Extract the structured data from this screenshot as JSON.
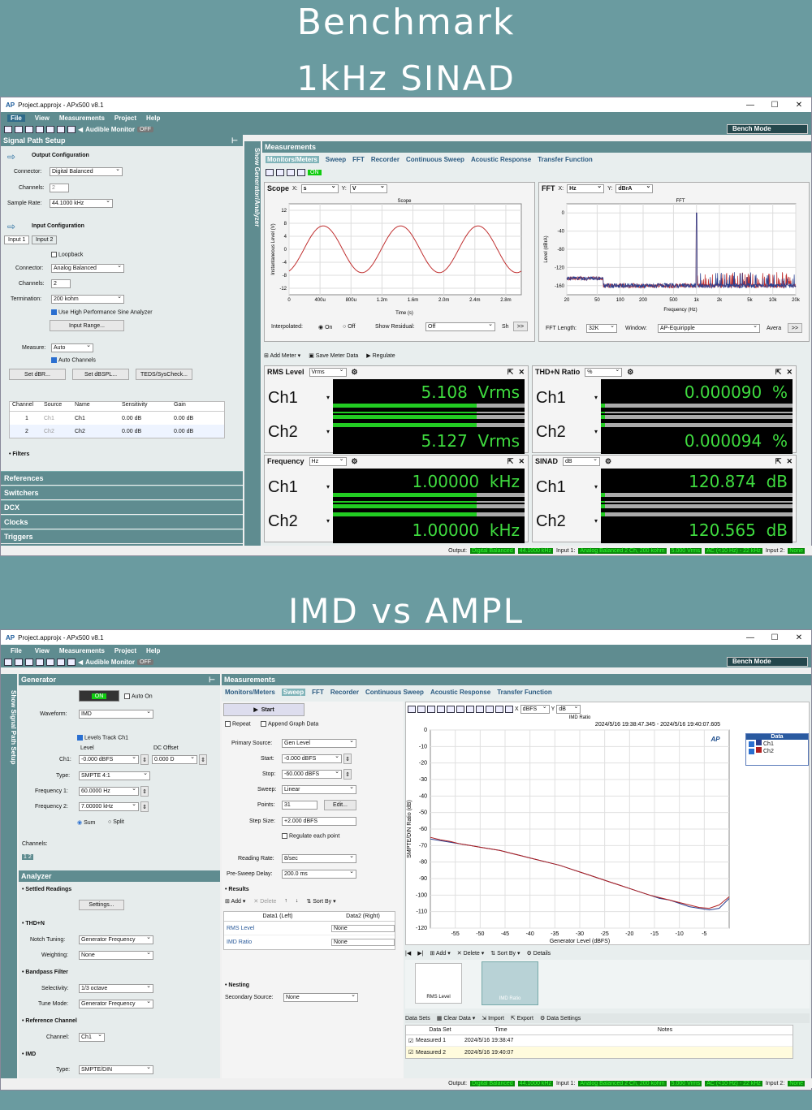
{
  "banner": {
    "line1": "Benchmark",
    "line2": "1kHz SINAD",
    "line3": "IMD vs AMPL"
  },
  "window": {
    "title": "Project.approjx - APx500 v8.1",
    "controls": [
      "—",
      "☐",
      "✕"
    ]
  },
  "menu": [
    "File",
    "View",
    "Measurements",
    "Project",
    "Help"
  ],
  "toolbar": {
    "audible": "Audible Monitor",
    "off": "OFF",
    "mode": "Bench Mode"
  },
  "top": {
    "signal_path_title": "Signal Path Setup",
    "show_gen": "Show Generator/Analyzer",
    "output_config": "Output Configuration",
    "connector_label": "Connector:",
    "connector_out": "Digital Balanced",
    "channels_label": "Channels:",
    "channels_out": "2",
    "sample_rate_label": "Sample Rate:",
    "sample_rate": "44.1000 kHz",
    "input_config": "Input Configuration",
    "input_tabs": [
      "Input 1",
      "Input 2"
    ],
    "loopback": "Loopback",
    "connector_in": "Analog Balanced",
    "channels_in": "2",
    "termination_label": "Termination:",
    "termination": "200 kohm",
    "hp_sine": "Use High Performance Sine Analyzer",
    "input_range": "Input Range...",
    "measure_label": "Measure:",
    "measure": "Auto",
    "auto_channels": "Auto Channels",
    "btn_dbr": "Set dBR...",
    "btn_dbspl": "Set dBSPL...",
    "btn_teds": "TEDS/SysCheck...",
    "table_headers": [
      "Channel",
      "Source",
      "Name",
      "Sensitivity",
      "Gain"
    ],
    "table_rows": [
      [
        "1",
        "Ch1",
        "Ch1",
        "0.00 dB",
        "0.00 dB"
      ],
      [
        "2",
        "Ch2",
        "Ch2",
        "0.00 dB",
        "0.00 dB"
      ]
    ],
    "filters": "• Filters",
    "nav": [
      "References",
      "Switchers",
      "DCX",
      "Clocks",
      "Triggers"
    ],
    "measurements_title": "Measurements",
    "meas_tabs": [
      "Monitors/Meters",
      "Sweep",
      "FFT",
      "Recorder",
      "Continuous Sweep",
      "Acoustic Response",
      "Transfer Function"
    ],
    "on": "ON",
    "scope": {
      "title": "Scope",
      "x_unit": "s",
      "y_unit": "V",
      "chart_title": "Scope",
      "ylabel": "Instantaneous Level (V)",
      "xlabel": "Time (s)",
      "xticks": [
        "0",
        "400u",
        "800u",
        "1.2m",
        "1.6m",
        "2.0m",
        "2.4m",
        "2.8m"
      ],
      "yticks": [
        "12",
        "8",
        "4",
        "0",
        "-4",
        "-8",
        "-12"
      ],
      "interpolated": "Interpolated:",
      "on": "On",
      "off": "Off",
      "show_residual": "Show Residual:",
      "residual": "Off",
      "sh": "Sh",
      "more": ">>"
    },
    "fft": {
      "title": "FFT",
      "x_unit": "Hz",
      "y_unit": "dBrA",
      "chart_title": "FFT",
      "ylabel": "Level (dBrA)",
      "xlabel": "Frequency (Hz)",
      "xticks": [
        "20",
        "50",
        "100",
        "200",
        "500",
        "1k",
        "2k",
        "5k",
        "10k",
        "20k"
      ],
      "yticks": [
        "0",
        "-40",
        "-80",
        "-120",
        "-160"
      ],
      "fft_length_label": "FFT Length:",
      "fft_length": "32K",
      "window_label": "Window:",
      "window": "AP-Equiripple",
      "avera": "Avera",
      "more": ">>"
    },
    "meter_bar": {
      "add": "Add Meter",
      "save": "Save Meter Data",
      "regulate": "Regulate"
    },
    "meters": [
      {
        "title": "RMS Level",
        "unit": "Vrms",
        "ch1": "5.108",
        "ch2": "5.127",
        "u": "Vrms"
      },
      {
        "title": "THD+N Ratio",
        "unit": "%",
        "ch1": "0.000090",
        "ch2": "0.000094",
        "u": "%"
      },
      {
        "title": "Frequency",
        "unit": "Hz",
        "ch1": "1.00000",
        "ch2": "1.00000",
        "u": "kHz"
      },
      {
        "title": "SINAD",
        "unit": "dB",
        "ch1": "120.874",
        "ch2": "120.565",
        "u": "dB"
      }
    ],
    "ch1": "Ch1",
    "ch2": "Ch2"
  },
  "status": {
    "output": "Output:",
    "out1": "Digital Balanced",
    "out2": "44.1000 kHz",
    "input1": "Input 1:",
    "in1": "Analog Balanced 2 Ch, 200 kohm",
    "in2": "5.000 Vrms",
    "in3": "AC (<10 Hz) - 22 kHz",
    "input2": "Input 2:",
    "none": "None"
  },
  "bottom": {
    "show_sps": "Show Signal Path Setup",
    "generator": "Generator",
    "on": "ON",
    "auto_on": "Auto On",
    "waveform_label": "Waveform:",
    "waveform": "IMD",
    "levels_track": "Levels Track Ch1",
    "level_hdr": "Level",
    "dc_hdr": "DC Offset",
    "ch1_label": "Ch1:",
    "ch1_level": "-0.000 dBFS",
    "ch1_dc": "0.000 D",
    "type_label": "Type:",
    "type": "SMPTE 4:1",
    "freq1_label": "Frequency 1:",
    "freq1": "60.0000 Hz",
    "freq2_label": "Frequency 2:",
    "freq2": "7.00000 kHz",
    "sum": "Sum",
    "split": "Split",
    "channels_label": "Channels:",
    "analyzer": "Analyzer",
    "settled": "• Settled Readings",
    "settings_btn": "Settings...",
    "thdn": "• THD+N",
    "notch_label": "Notch Tuning:",
    "notch": "Generator Frequency",
    "weighting_label": "Weighting:",
    "weighting": "None",
    "bandpass": "• Bandpass Filter",
    "selectivity_label": "Selectivity:",
    "selectivity": "1/3 octave",
    "tune_label": "Tune Mode:",
    "tune": "Generator Frequency",
    "refch": "• Reference Channel",
    "channel_label": "Channel:",
    "channel": "Ch1",
    "imd": "• IMD",
    "imd_type_label": "Type:",
    "imd_type": "SMPTE/DIN",
    "measurements_title": "Measurements",
    "start": "Start",
    "repeat": "Repeat",
    "append": "Append Graph Data",
    "primary_label": "Primary Source:",
    "primary": "Gen Level",
    "start_label": "Start:",
    "start_val": "-0.000 dBFS",
    "stop_label": "Stop:",
    "stop_val": "-60.000 dBFS",
    "sweep_label": "Sweep:",
    "sweep": "Linear",
    "points_label": "Points:",
    "points": "31",
    "edit": "Edit...",
    "step_label": "Step Size:",
    "step": "+2.000 dBFS",
    "regulate": "Regulate each point",
    "reading_label": "Reading Rate:",
    "reading": "8/sec",
    "presweep_label": "Pre-Sweep Delay:",
    "presweep": "200.0 ms",
    "results": "• Results",
    "add": "Add",
    "delete": "Delete",
    "sortby": "Sort By",
    "res_headers": [
      "Data1 (Left)",
      "Data2 (Right)"
    ],
    "res_rows": [
      [
        "RMS Level",
        "None"
      ],
      [
        "IMD Ratio",
        "None"
      ]
    ],
    "nesting": "• Nesting",
    "secondary_label": "Secondary Source:",
    "secondary": "None",
    "graph": {
      "x_unit": "dBFS",
      "y_unit": "dB",
      "title": "IMD Ratio",
      "timestamp": "2024/5/16 19:38:47.345 - 2024/5/16 19:40:07.605",
      "ylabel": "SMPTE/DIN Ratio (dB)",
      "xlabel": "Generator Level (dBFS)",
      "xticks": [
        "-55",
        "-50",
        "-45",
        "-40",
        "-35",
        "-30",
        "-25",
        "-20",
        "-15",
        "-10",
        "-5"
      ],
      "yticks": [
        "0",
        "-10",
        "-20",
        "-30",
        "-40",
        "-50",
        "-60",
        "-70",
        "-80",
        "-90",
        "-100",
        "-110",
        "-120"
      ],
      "legend_title": "Data",
      "legend": [
        "Ch1",
        "Ch2"
      ],
      "ap": "AP"
    },
    "ctrl": {
      "add": "Add",
      "delete": "Delete",
      "sortby": "Sort By",
      "details": "Details"
    },
    "thumbs": [
      "RMS Level",
      "IMD Ratio"
    ],
    "datasets": {
      "label": "Data Sets",
      "clear": "Clear Data",
      "import": "Import",
      "export": "Export",
      "settings": "Data Settings",
      "headers": [
        "Data Set",
        "Time",
        "Notes"
      ],
      "rows": [
        [
          "Measured 1",
          "2024/5/16 19:38:47"
        ],
        [
          "Measured 2",
          "2024/5/16 19:40:07"
        ]
      ]
    }
  },
  "chart_data": [
    {
      "type": "line",
      "title": "Scope",
      "xlabel": "Time (s)",
      "ylabel": "Instantaneous Level (V)",
      "xlim": [
        0,
        0.003
      ],
      "ylim": [
        -14,
        14
      ],
      "series": [
        {
          "values": "sine 1kHz amplitude 7.2 V"
        }
      ]
    },
    {
      "type": "line",
      "title": "FFT",
      "xlabel": "Frequency (Hz)",
      "ylabel": "Level (dBrA)",
      "xlim": [
        20,
        20000
      ],
      "ylim": [
        -180,
        20
      ],
      "log_x": true,
      "peak": {
        "x": 1000,
        "y": 0
      }
    },
    {
      "type": "line",
      "title": "IMD Ratio",
      "xlabel": "Generator Level (dBFS)",
      "ylabel": "SMPTE/DIN Ratio (dB)",
      "xlim": [
        -60,
        0
      ],
      "ylim": [
        -120,
        0
      ],
      "x": [
        -60,
        -58,
        -56,
        -54,
        -52,
        -50,
        -48,
        -46,
        -44,
        -42,
        -40,
        -38,
        -36,
        -34,
        -32,
        -30,
        -28,
        -26,
        -24,
        -22,
        -20,
        -18,
        -16,
        -14,
        -12,
        -10,
        -8,
        -6,
        -4,
        -2,
        0
      ],
      "series": [
        {
          "name": "Ch1",
          "color": "#2a3f8f",
          "values": [
            -66,
            -67,
            -68,
            -69,
            -70,
            -71,
            -72,
            -73,
            -74.5,
            -76,
            -77.5,
            -79,
            -80.5,
            -82,
            -84,
            -86,
            -88,
            -90,
            -92,
            -94,
            -96,
            -98,
            -100,
            -102,
            -103,
            -105,
            -107,
            -108,
            -109,
            -108,
            -102
          ]
        },
        {
          "name": "Ch2",
          "color": "#b02020",
          "values": [
            -65,
            -66.5,
            -67.5,
            -69,
            -70,
            -71,
            -72,
            -73,
            -74.5,
            -76,
            -77.5,
            -79,
            -80.5,
            -82,
            -84,
            -86,
            -88,
            -90,
            -92,
            -94,
            -96,
            -98,
            -100,
            -101.5,
            -103,
            -104.5,
            -106,
            -107.5,
            -108,
            -106,
            -101
          ]
        }
      ]
    }
  ],
  "colors": {
    "teal": "#5f8c90",
    "meter_green": "#3fdc3f",
    "ch1": "#2a3f8f",
    "ch2": "#b02020"
  }
}
